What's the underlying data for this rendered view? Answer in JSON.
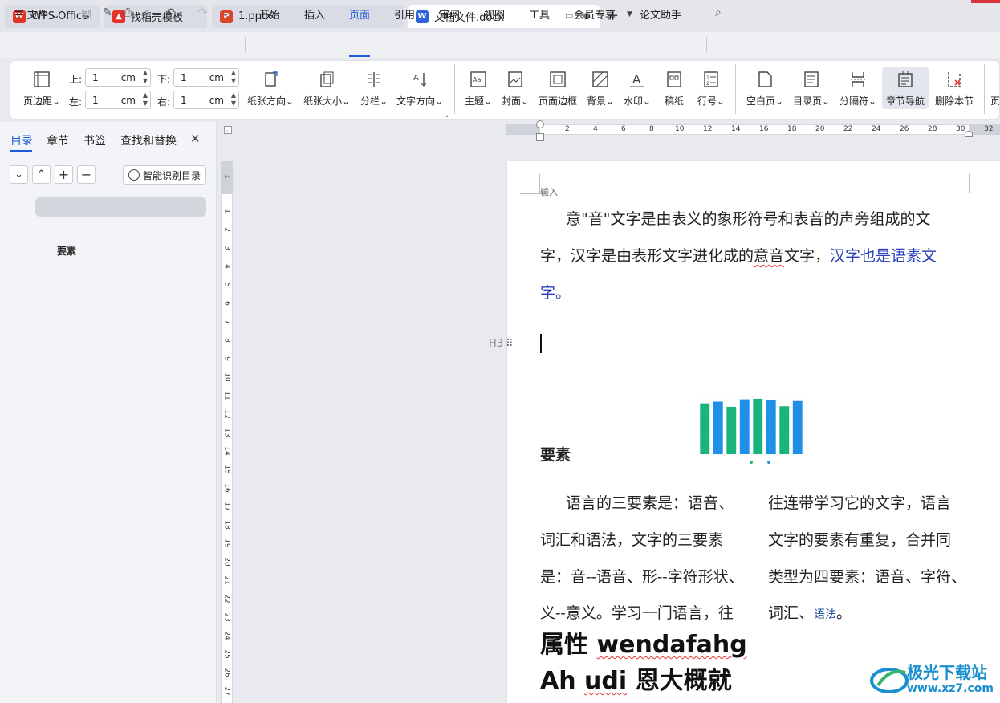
{
  "tabs": [
    {
      "label": "WPS Office",
      "icon": "wps-logo-icon"
    },
    {
      "label": "找稻壳模板",
      "icon": "docer-icon"
    },
    {
      "label": "1.pptx",
      "icon": "ppt-icon"
    },
    {
      "label": "文档文件.docx",
      "icon": "word-icon"
    }
  ],
  "menu": {
    "file": "文件",
    "items": [
      "开始",
      "插入",
      "页面",
      "引用",
      "审阅",
      "视图",
      "工具",
      "会员专享",
      "论文助手"
    ],
    "active": "页面"
  },
  "ribbon": {
    "margins_label": "页边距",
    "top_label": "上:",
    "bottom_label": "下:",
    "left_label": "左:",
    "right_label": "右:",
    "top_value": "1",
    "bottom_value": "1",
    "left_value": "1",
    "right_value": "1",
    "unit": "cm",
    "buttons": [
      "纸张方向",
      "纸张大小",
      "分栏",
      "文字方向",
      "主题",
      "封面",
      "页面边框",
      "背景",
      "水印",
      "稿纸",
      "行号",
      "空白页",
      "目录页",
      "分隔符",
      "章节导航",
      "删除本节"
    ],
    "highlighted": "章节导航",
    "truncated": "页"
  },
  "nav": {
    "tabs": [
      "目录",
      "章节",
      "书签",
      "查找和替换"
    ],
    "active": "目录",
    "smart_button": "智能识别目录",
    "toc_items": [
      "要素"
    ]
  },
  "ruler": {
    "h_ticks": [
      "2",
      "4",
      "6",
      "8",
      "10",
      "12",
      "14",
      "16",
      "18",
      "20",
      "22",
      "24",
      "26",
      "28",
      "30",
      "32"
    ],
    "v_ticks": [
      "1",
      "1",
      "2",
      "3",
      "4",
      "5",
      "6",
      "7",
      "8",
      "9",
      "10",
      "11",
      "12",
      "13",
      "14",
      "15",
      "16",
      "17",
      "18",
      "19",
      "20",
      "21",
      "22",
      "23",
      "24",
      "25",
      "26",
      "27"
    ]
  },
  "doc": {
    "header_label": "输入",
    "para1_line1": "意\"音\"文字是由表义的象形符号和表音的声旁组成的文",
    "para1_line2_a": "字，汉字是由表形文字进化成的",
    "para1_line2_b": "意音",
    "para1_line2_c": "文字，",
    "para1_line2_d": "汉字也是语素文",
    "para1_line3": "字。",
    "heading_tag": "H3",
    "heading": "要素",
    "col1": [
      "语言的三要素是：语音、",
      "词汇和语法，文字的三要素",
      "是：音--语音、形--字符形状、",
      "义--意义。学习一门语言，往"
    ],
    "col2": [
      "往连带学习它的文字，语言",
      "文字的要素有重复，合并同",
      "类型为四要素：语音、字符、",
      "词汇、"
    ],
    "col2_tail": "语法",
    "col2_end": "。",
    "big1_a": "属性 ",
    "big1_b": "wendafahg",
    "big2_a": "Ah ",
    "big2_b": "udi",
    "big2_c": " 恩大概就"
  },
  "chart_data": {
    "type": "bar",
    "values": [
      8.8,
      9.1,
      8.2,
      9.5,
      9.6,
      9.3,
      8.3,
      9.2
    ],
    "colors": [
      "#19b37d",
      "#1f8fe8",
      "#19b37d",
      "#1f8fe8",
      "#19b37d",
      "#1f8fe8",
      "#19b37d",
      "#1f8fe8"
    ],
    "ylim": [
      0,
      10
    ]
  },
  "watermark": {
    "line1": "极光下载站",
    "line2": "www.xz7.com"
  }
}
